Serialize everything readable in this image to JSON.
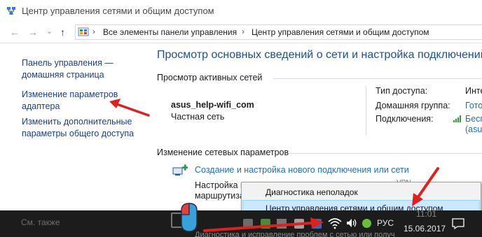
{
  "window": {
    "title": "Центр управления сетями и общим доступом"
  },
  "nav": {
    "back": "←",
    "forward": "→",
    "recent": "⌄",
    "up": "↑",
    "breadcrumbs": [
      "Все элементы панели управления",
      "Центр управления сетями и общим доступом"
    ],
    "sep": "›",
    "addr_sep": "›"
  },
  "sidebar": {
    "home_line1": "Панель управления —",
    "home_line2": "домашняя страница",
    "adapter_line1": "Изменение параметров",
    "adapter_line2": "адаптера",
    "sharing_line1": "Изменить дополнительные",
    "sharing_line2": "параметры общего доступа",
    "see_also": "См. также"
  },
  "main": {
    "title": "Просмотр основных сведений о сети и настройка подключений",
    "active_networks": "Просмотр активных сетей",
    "network": {
      "name": "asus_help-wifi_com",
      "type": "Частная сеть",
      "access_type_label": "Тип доступа:",
      "access_type_value": "Инте",
      "homegroup_label": "Домашняя группа:",
      "homegroup_value": "Гото",
      "connections_label": "Подключения:",
      "connections_value1": "Бесп",
      "connections_value2": "(asus"
    },
    "change_settings": "Изменение сетевых параметров",
    "new_connection": "Создание и настройка нового подключения или сети",
    "partial_line1": "Настройка ш",
    "partial_line2": "маршрутиза",
    "partial_vpn": "VPN",
    "bottom_partial": "Диагностика и исправление проблем с сетью или получ"
  },
  "context_menu": {
    "items": [
      "Диагностика неполадок",
      "Центр управления сетями и общим доступом"
    ],
    "selected_index": 1
  },
  "taskbar": {
    "lang": "РУС",
    "time": "11:01",
    "date": "15.06.2017"
  },
  "colors": {
    "link": "#1c3f94",
    "title": "#1e4f9c",
    "arrow": "#e02020",
    "taskbar": "#1c1c1c",
    "menu_highlight": "#cce8ff"
  }
}
